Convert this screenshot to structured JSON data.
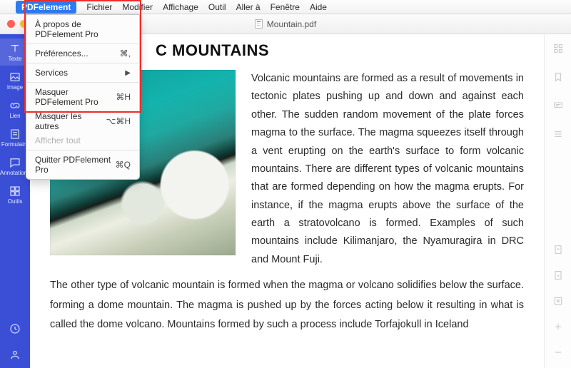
{
  "menubar": {
    "items": [
      "PDFelement",
      "Fichier",
      "Modifier",
      "Affichage",
      "Outil",
      "Aller à",
      "Fenêtre",
      "Aide"
    ]
  },
  "dropdown": {
    "about": "À propos de PDFelement Pro",
    "prefs": "Préférences...",
    "prefs_sc": "⌘,",
    "services": "Services",
    "hide_app": "Masquer PDFelement Pro",
    "hide_app_sc": "⌘H",
    "hide_others": "Masquer les autres",
    "hide_others_sc": "⌥⌘H",
    "show_all": "Afficher tout",
    "quit": "Quitter PDFelement Pro",
    "quit_sc": "⌘Q"
  },
  "window": {
    "title": "Mountain.pdf"
  },
  "sidebar": {
    "t0": "Texte",
    "t1": "Image",
    "t2": "Lien",
    "t3": "Formulaire",
    "t4": "Annotations",
    "t5": "Outils"
  },
  "doc": {
    "heading_visible": "C MOUNTAINS",
    "para1": "Volcanic mountains are formed as a result of movements in tectonic plates pushing up and down and against each other. The sudden random movement of the plate forces magma to the surface. The magma squeezes itself through a vent erupting on the earth's surface to form volcanic mountains. There are different types of volcanic mountains that are formed depending on how the magma erupts. For instance, if the magma erupts above the surface of the earth a stratovolcano is formed. Examples of such mountains include Kilimanjaro, the Nyamuragira in DRC and Mount Fuji.",
    "para2": "The other type of volcanic mountain is formed when the magma or volcano solidifies below the surface. forming a dome mountain. The magma is pushed up by the forces acting below it resulting in what is called the dome volcano. Mountains formed by such a process include Torfajokull in Iceland"
  }
}
